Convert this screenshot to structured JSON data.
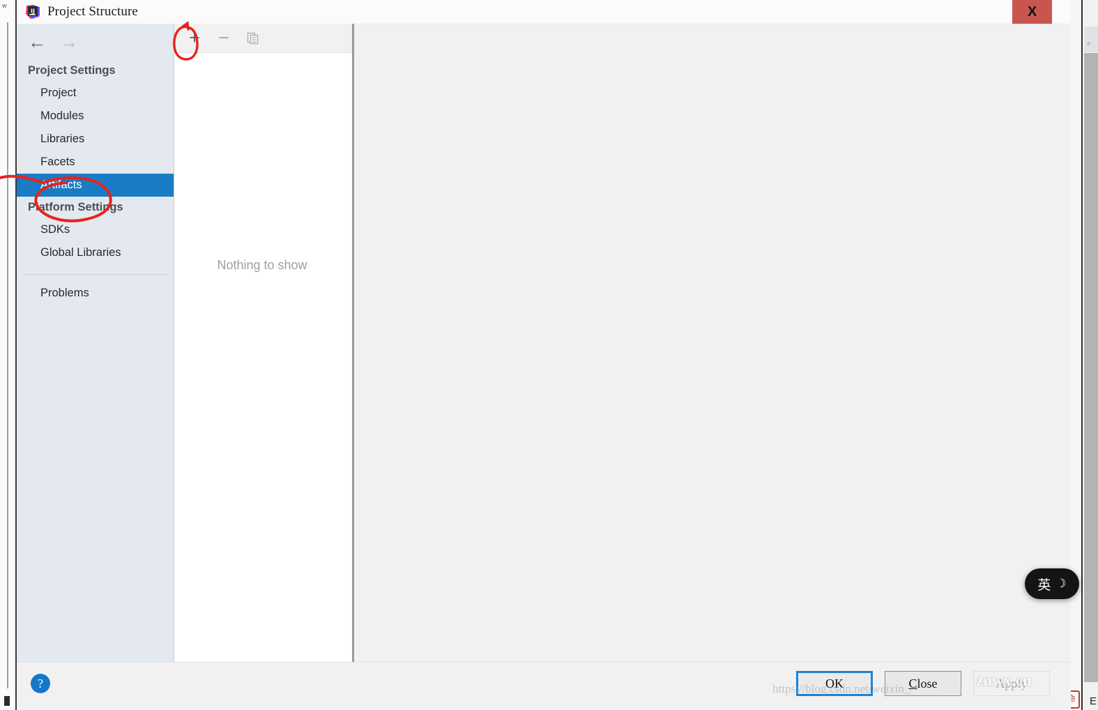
{
  "window": {
    "title": "Project Structure",
    "app_icon": "intellij-idea-icon",
    "close_label": "X"
  },
  "nav": {
    "back_icon": "←",
    "forward_icon": "→",
    "groups": [
      {
        "label": "Project Settings",
        "items": [
          {
            "label": "Project",
            "selected": false
          },
          {
            "label": "Modules",
            "selected": false
          },
          {
            "label": "Libraries",
            "selected": false
          },
          {
            "label": "Facets",
            "selected": false
          },
          {
            "label": "Artifacts",
            "selected": true
          }
        ]
      },
      {
        "label": "Platform Settings",
        "items": [
          {
            "label": "SDKs",
            "selected": false
          },
          {
            "label": "Global Libraries",
            "selected": false
          }
        ]
      }
    ],
    "extra_items": [
      {
        "label": "Problems",
        "selected": false
      }
    ]
  },
  "list_panel": {
    "toolbar": [
      {
        "name": "add-button",
        "glyph": "+",
        "enabled": true
      },
      {
        "name": "remove-button",
        "glyph": "−",
        "enabled": false
      },
      {
        "name": "duplicate-button",
        "glyph": "copy",
        "enabled": false
      }
    ],
    "empty_text": "Nothing to show"
  },
  "footer": {
    "help_label": "?",
    "buttons": [
      {
        "label": "OK",
        "state": "default"
      },
      {
        "label": "Close",
        "state": "normal",
        "mnemonic": "C"
      },
      {
        "label": "Apply",
        "state": "disabled"
      }
    ]
  },
  "overlay": {
    "ime_language": "英",
    "ime_moon": "☽",
    "watermark": "https://blog.csdn.net/weixin_",
    "watermark_strong": "znwx.cn",
    "bg_right_letter": "E",
    "annotation_color": "#e8231f"
  },
  "colors": {
    "selection_blue": "#1a7cc4",
    "titlebar_bg": "#fbfbfb",
    "sidebar_bg": "#e4e9ef",
    "panel_bg": "#f1f1f1",
    "close_red": "#c9564e",
    "help_blue": "#1477c9",
    "focus_blue": "#1b84d8"
  }
}
